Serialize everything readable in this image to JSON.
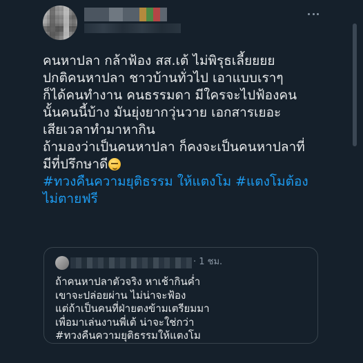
{
  "tweet": {
    "author_blurred": true,
    "more_icon": "more-horizontal-icon",
    "text_lines": [
      "คนหาปลา กล้าฟ้อง สส.เต้ ไม่พิรุธเลี้ยยยย",
      "ปกติคนหาปลา ชาวบ้านทั่วไป เอาแบบเราๆ",
      "ก็ได้คนทำงาน คนธรรมดา มีใครจะไปฟ้องคน",
      "นั้นคนนี้บ้าง มันยุ่งยากวุ่นวาย เอกสารเยอะ",
      "เสียเวลาทำมาหากิน",
      "ถ้ามองว่าเป็นคนหาปลา ก็คงจะเป็นคนหาปลาที่",
      "มีที่ปรึกษาดี"
    ],
    "emoji": "smirking-face-emoji",
    "hashtag_lines": [
      "#ทวงคืนความยุติธรรม ให้แตงโม #แตงโมต้อง",
      "ไม่ตายฟรี"
    ],
    "hashtag_color": "#1d9bf0"
  },
  "quote": {
    "time": "· 1 ชม.",
    "lines": [
      "ถ้าคนหาปลาตัวจริง หาเช้ากินค่ำ",
      "เขาจะปล่อยผ่าน ไม่น่าจะฟ้อง",
      "แต่ถ้าเป็นคนที่ฝ่ายตงข้ามเตรียมมา",
      "เพื่อมาเล่นงานพี่เต้ น่าจะใช่กว่า",
      "#ทวงคืนความยุติธรรมให้แตงโม"
    ]
  },
  "colors": {
    "background": "#15202b",
    "text": "#e7e9ea",
    "secondary": "#8b98a5",
    "border": "#38444d"
  }
}
